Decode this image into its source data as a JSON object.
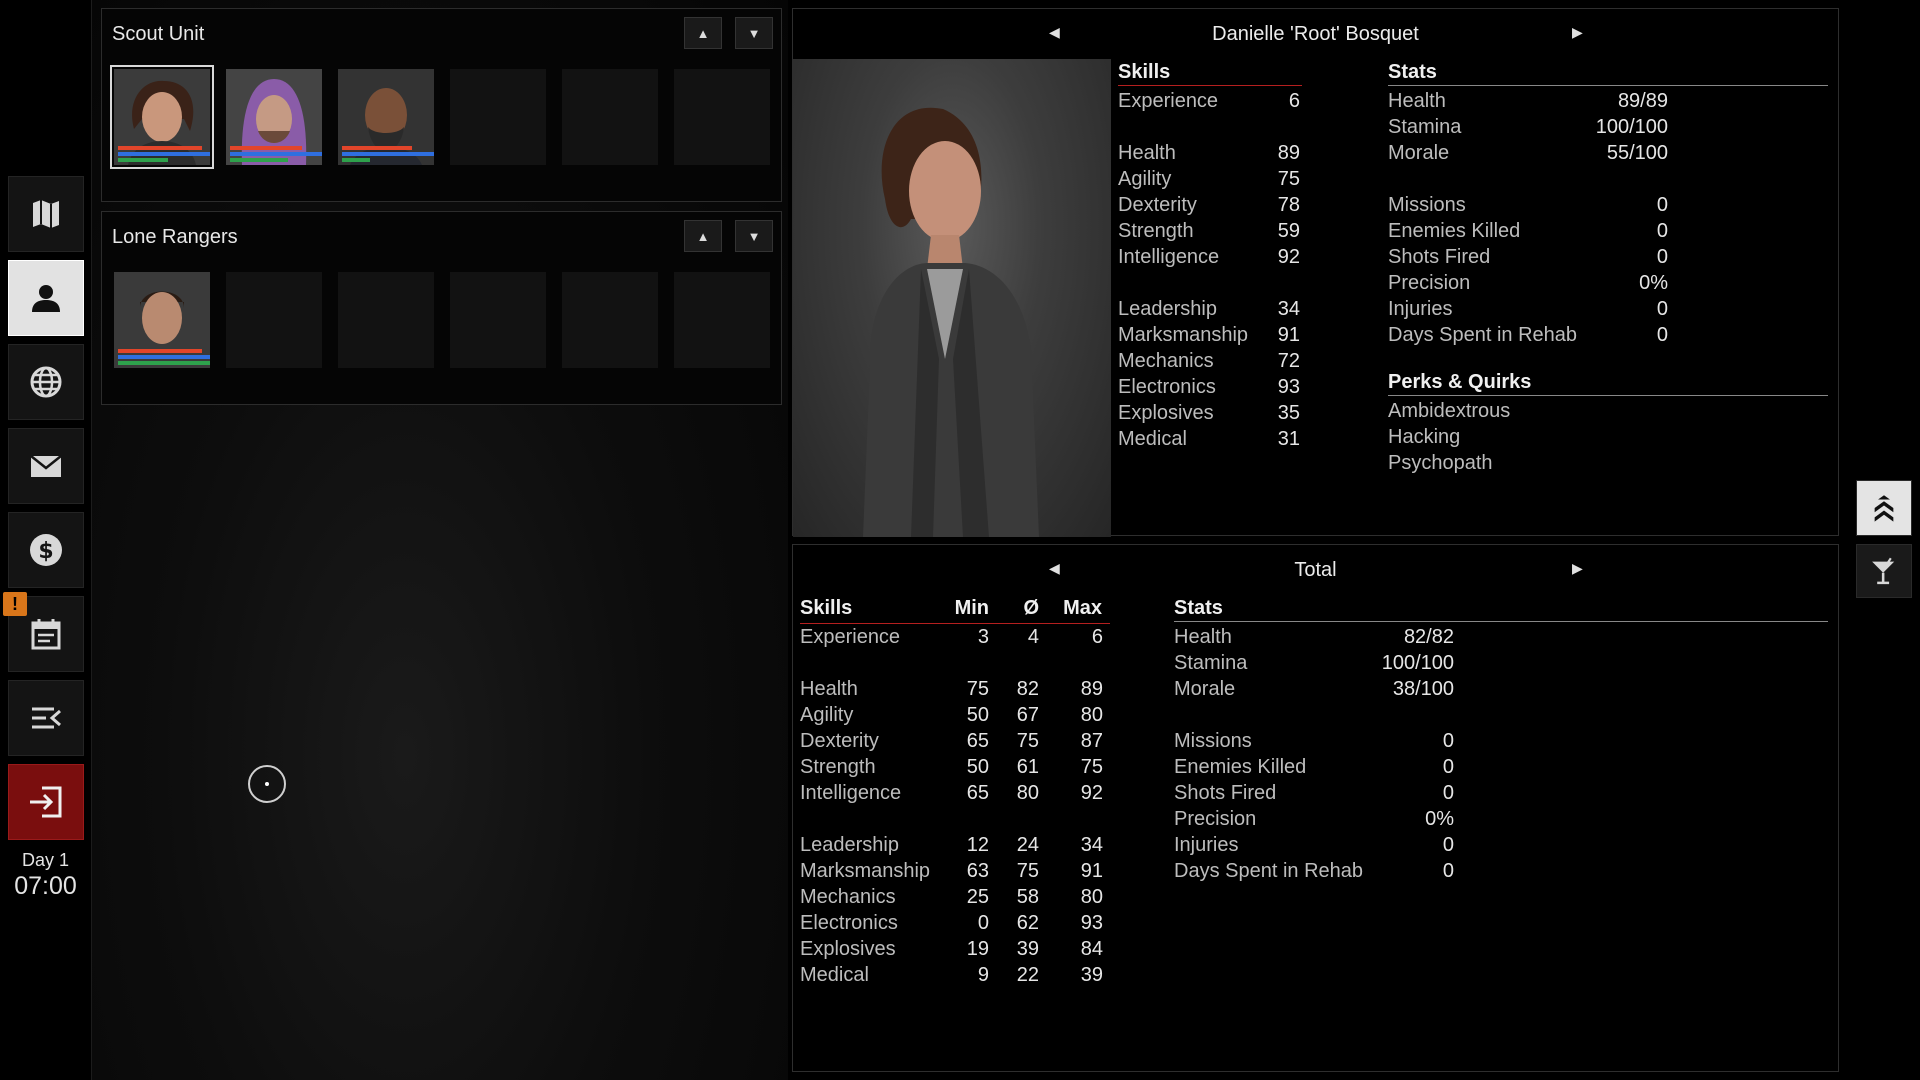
{
  "sidebar": {
    "nav": [
      {
        "name": "map-button",
        "icon": "map-icon"
      },
      {
        "name": "personnel-button",
        "icon": "person-icon",
        "active": true
      },
      {
        "name": "globe-button",
        "icon": "globe-icon"
      },
      {
        "name": "mail-button",
        "icon": "mail-icon"
      },
      {
        "name": "finance-button",
        "icon": "dollar-icon"
      },
      {
        "name": "calendar-button",
        "icon": "calendar-icon",
        "badge": "!"
      },
      {
        "name": "menu-button",
        "icon": "menu-collapse-icon"
      },
      {
        "name": "exit-button",
        "icon": "exit-icon"
      }
    ],
    "day": "Day 1",
    "time": "07:00"
  },
  "squads": [
    {
      "title": "Scout Unit",
      "members": 3
    },
    {
      "title": "Lone Rangers",
      "members": 1
    }
  ],
  "character": {
    "name": "Danielle 'Root' Bosquet",
    "skills_title": "Skills",
    "stats_title": "Stats",
    "perks_title": "Perks & Quirks",
    "skills": [
      {
        "label": "Experience",
        "value": "6"
      },
      {
        "label": "Health",
        "value": "89"
      },
      {
        "label": "Agility",
        "value": "75"
      },
      {
        "label": "Dexterity",
        "value": "78"
      },
      {
        "label": "Strength",
        "value": "59"
      },
      {
        "label": "Intelligence",
        "value": "92"
      },
      {
        "label": "Leadership",
        "value": "34"
      },
      {
        "label": "Marksmanship",
        "value": "91"
      },
      {
        "label": "Mechanics",
        "value": "72"
      },
      {
        "label": "Electronics",
        "value": "93"
      },
      {
        "label": "Explosives",
        "value": "35"
      },
      {
        "label": "Medical",
        "value": "31"
      }
    ],
    "stats": [
      {
        "label": "Health",
        "value": "89/89"
      },
      {
        "label": "Stamina",
        "value": "100/100"
      },
      {
        "label": "Morale",
        "value": "55/100"
      },
      {
        "label": "Missions",
        "value": "0"
      },
      {
        "label": "Enemies Killed",
        "value": "0"
      },
      {
        "label": "Shots Fired",
        "value": "0"
      },
      {
        "label": "Precision",
        "value": "0%"
      },
      {
        "label": "Injuries",
        "value": "0"
      },
      {
        "label": "Days Spent in Rehab",
        "value": "0"
      }
    ],
    "perks": [
      "Ambidextrous",
      "Hacking",
      "Psychopath"
    ]
  },
  "total": {
    "title": "Total",
    "skills_title": "Skills",
    "col_min": "Min",
    "col_avg": "Ø",
    "col_max": "Max",
    "stats_title": "Stats",
    "skills": [
      {
        "label": "Experience",
        "min": "3",
        "avg": "4",
        "max": "6"
      },
      {
        "label": "Health",
        "min": "75",
        "avg": "82",
        "max": "89"
      },
      {
        "label": "Agility",
        "min": "50",
        "avg": "67",
        "max": "80"
      },
      {
        "label": "Dexterity",
        "min": "65",
        "avg": "75",
        "max": "87"
      },
      {
        "label": "Strength",
        "min": "50",
        "avg": "61",
        "max": "75"
      },
      {
        "label": "Intelligence",
        "min": "65",
        "avg": "80",
        "max": "92"
      },
      {
        "label": "Leadership",
        "min": "12",
        "avg": "24",
        "max": "34"
      },
      {
        "label": "Marksmanship",
        "min": "63",
        "avg": "75",
        "max": "91"
      },
      {
        "label": "Mechanics",
        "min": "25",
        "avg": "58",
        "max": "80"
      },
      {
        "label": "Electronics",
        "min": "0",
        "avg": "62",
        "max": "93"
      },
      {
        "label": "Explosives",
        "min": "19",
        "avg": "39",
        "max": "84"
      },
      {
        "label": "Medical",
        "min": "9",
        "avg": "22",
        "max": "39"
      }
    ],
    "stats": [
      {
        "label": "Health",
        "value": "82/82"
      },
      {
        "label": "Stamina",
        "value": "100/100"
      },
      {
        "label": "Morale",
        "value": "38/100"
      },
      {
        "label": "Missions",
        "value": "0"
      },
      {
        "label": "Enemies Killed",
        "value": "0"
      },
      {
        "label": "Shots Fired",
        "value": "0"
      },
      {
        "label": "Precision",
        "value": "0%"
      },
      {
        "label": "Injuries",
        "value": "0"
      },
      {
        "label": "Days Spent in Rehab",
        "value": "0"
      }
    ]
  },
  "right_buttons": [
    {
      "name": "rank-button",
      "icon": "rank-chevron-icon",
      "active": true
    },
    {
      "name": "bar-button",
      "icon": "cocktail-icon"
    }
  ],
  "colors": {
    "accent_red": "#b51f1f",
    "health_bar": "#e2452a",
    "stamina_bar": "#2f6fe0",
    "morale_bar": "#2ea14c"
  }
}
